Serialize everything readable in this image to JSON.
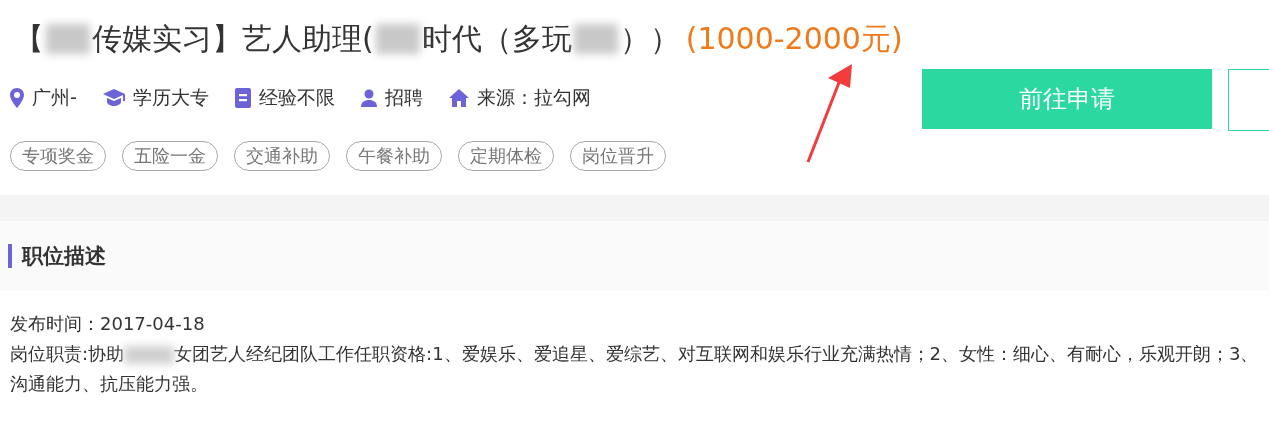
{
  "title": {
    "segments": [
      {
        "kind": "text",
        "text": "【"
      },
      {
        "kind": "redacted"
      },
      {
        "kind": "text",
        "text": "传媒实习】艺人助理("
      },
      {
        "kind": "redacted"
      },
      {
        "kind": "text",
        "text": "时代（多玩"
      },
      {
        "kind": "redacted"
      },
      {
        "kind": "text",
        "text": "））"
      }
    ],
    "salary": "(1000-2000元)"
  },
  "meta": [
    {
      "kind": "location",
      "text": "广州-"
    },
    {
      "kind": "education",
      "text": "学历大专"
    },
    {
      "kind": "experience",
      "text": "经验不限"
    },
    {
      "kind": "person",
      "text": "招聘"
    },
    {
      "kind": "home",
      "text": "来源：拉勾网"
    }
  ],
  "tags": [
    "专项奖金",
    "五险一金",
    "交通补助",
    "午餐补助",
    "定期体检",
    "岗位晋升"
  ],
  "apply_button": "前往申请",
  "section": {
    "heading": "职位描述",
    "posted": "发布时间：2017-04-18",
    "description": [
      {
        "kind": "text",
        "text": "岗位职责:协助"
      },
      {
        "kind": "redacted"
      },
      {
        "kind": "text",
        "text": "女团艺人经纪团队工作任职资格:1、爱娱乐、爱追星、爱综艺、对互联网和娱乐行业充满热情；2、女性：细心、有耐心，乐观开朗；3、沟通能力、抗压能力强。"
      }
    ]
  }
}
